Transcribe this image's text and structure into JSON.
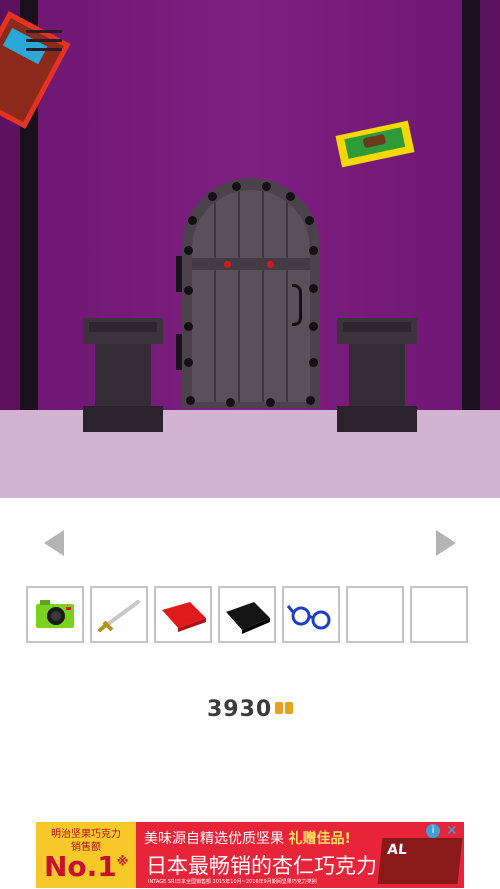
{
  "scene": {
    "name": "purple-room-with-door",
    "colors": {
      "wall": "#7a1f7d",
      "floor": "#d2b4d2",
      "door": "#4b424b",
      "stud": "#141014",
      "red_dot": "#d11b1b"
    }
  },
  "navigation": {
    "left_icon": "triangle-left-icon",
    "right_icon": "triangle-right-icon"
  },
  "inventory": {
    "slots": [
      {
        "item": "camera",
        "icon": "camera-icon"
      },
      {
        "item": "sword",
        "icon": "sword-icon"
      },
      {
        "item": "red-book",
        "icon": "red-book-icon"
      },
      {
        "item": "black-book",
        "icon": "black-book-icon"
      },
      {
        "item": "glasses",
        "icon": "glasses-icon"
      },
      {
        "item": "",
        "icon": ""
      },
      {
        "item": "",
        "icon": ""
      }
    ]
  },
  "logo": {
    "text": "3930"
  },
  "ad": {
    "brand": "明治坚果巧克力",
    "sub": "销售额",
    "rank": "No.1",
    "rank_mark": "※",
    "line1_a": "美味源自精选优质坚果",
    "line1_b": "礼赠佳品!",
    "line2": "日本最畅销的杏仁巧克力",
    "fine_print": "INTAGE SRI日本全国销售额 2015年10月~2016年9月期间坚果巧克力类别",
    "product": "AL",
    "info": "i",
    "close": "✕"
  }
}
